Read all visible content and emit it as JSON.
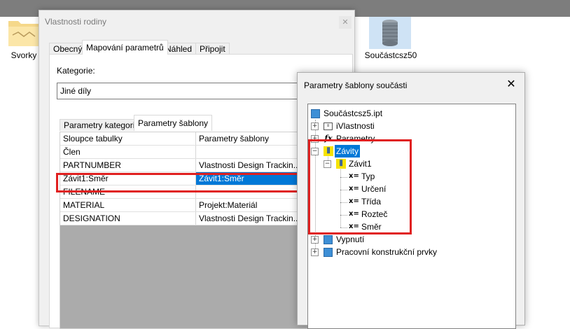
{
  "desktop": {
    "folder_label": "Svorky",
    "part_label": "Součástcsz50"
  },
  "family_dialog": {
    "title": "Vlastnosti rodiny",
    "close_glyph": "✕",
    "tabs": [
      "Obecný",
      "Mapování parametrů",
      "Náhled",
      "Připojit"
    ],
    "active_tab": "Mapování parametrů",
    "category_label": "Kategorie:",
    "category_value": "Jiné díly",
    "subtabs": [
      "Parametry kategorie",
      "Parametry šablony"
    ],
    "table": {
      "headers": [
        "Sloupce tabulky",
        "Parametry šablony"
      ],
      "rows": [
        [
          "Člen",
          ""
        ],
        [
          "PARTNUMBER",
          "Vlastnosti Design Trackin..."
        ],
        [
          "Závit1:Směr",
          "Závit1:Směr"
        ],
        [
          "FILENAME",
          ""
        ],
        [
          "MATERIAL",
          "Projekt:Materiál"
        ],
        [
          "DESIGNATION",
          "Vlastnosti Design Trackin..."
        ]
      ]
    }
  },
  "template_dialog": {
    "title": "Parametry šablony součásti",
    "close_glyph": "✕",
    "tree": {
      "root": "Součástcsz5.ipt",
      "items": {
        "ivlastnosti": "iVlastnosti",
        "parametry": "Parametry",
        "zavity": "Závity",
        "zavit1": "Závit1",
        "typ": "Typ",
        "urceni": "Určení",
        "trida": "Třída",
        "roztec": "Rozteč",
        "smer": "Směr",
        "vypnuti": "Vypnutí",
        "pracovni": "Pracovní konstrukční prvky"
      },
      "icons": {
        "fx": "fx",
        "x_eq": "x=",
        "plus": "+",
        "minus": "−"
      }
    }
  },
  "colors": {
    "selection": "#0078d7",
    "highlight": "#e02020"
  }
}
